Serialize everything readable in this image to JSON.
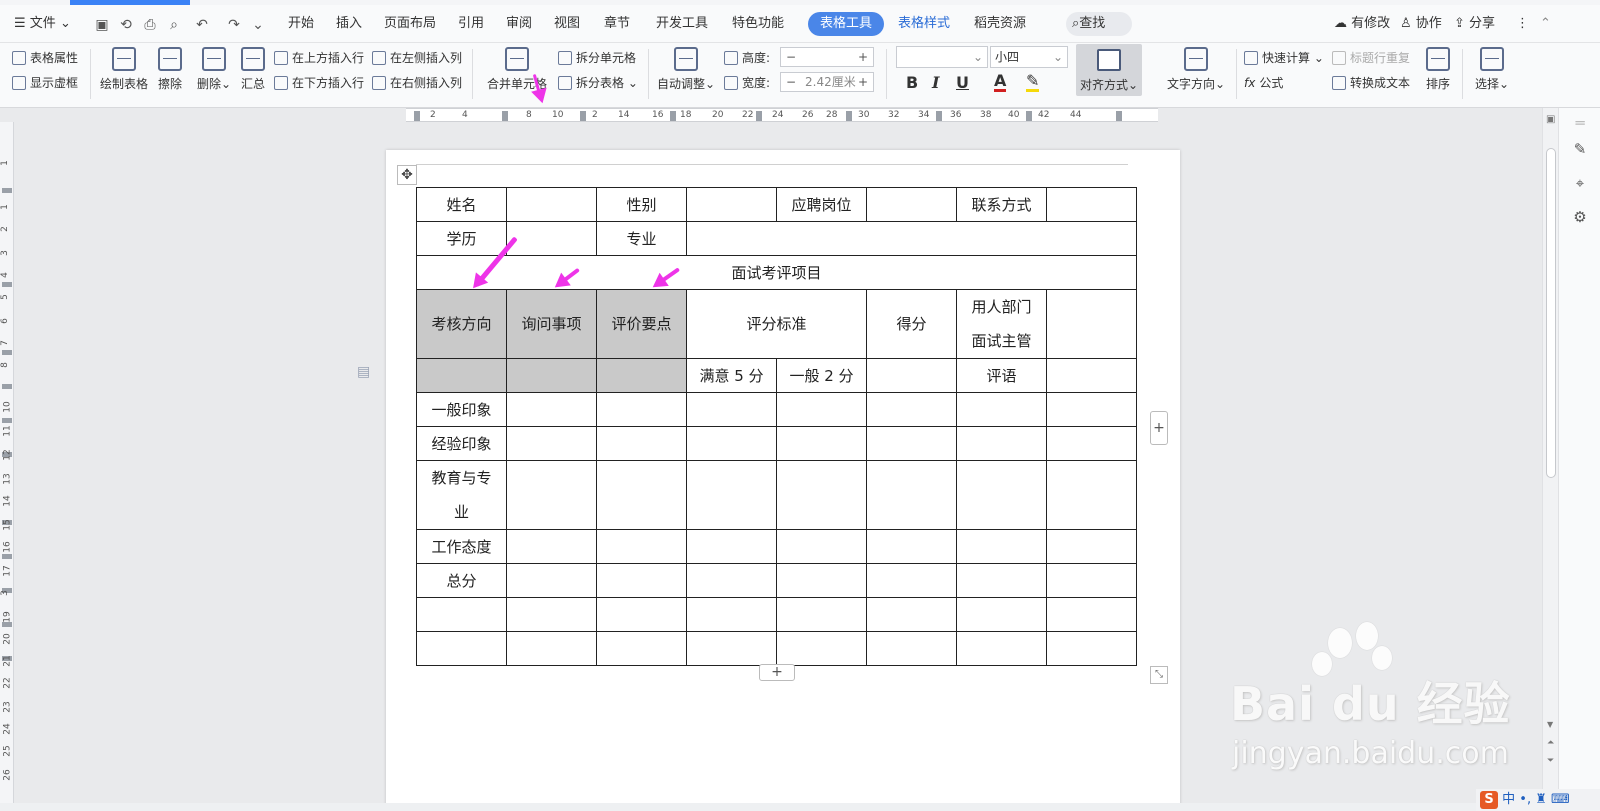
{
  "menubar": {
    "file": "文件",
    "tabs": [
      "开始",
      "插入",
      "页面布局",
      "引用",
      "审阅",
      "视图",
      "章节",
      "开发工具",
      "特色功能"
    ],
    "table_tools": "表格工具",
    "table_style": "表格样式",
    "docer": "稻壳资源",
    "search": "查找",
    "has_changes": "有修改",
    "collab": "协作",
    "share": "分享"
  },
  "ribbon": {
    "table_props": "表格属性",
    "show_grid": "显示虚框",
    "draw_table": "绘制表格",
    "erase": "擦除",
    "delete": "删除",
    "summary": "汇总",
    "insert_above": "在上方插入行",
    "insert_below": "在下方插入行",
    "insert_left": "在左侧插入列",
    "insert_right": "在右侧插入列",
    "merge_cells": "合并单元格",
    "split_cells": "拆分单元格",
    "split_table": "拆分表格",
    "auto_adjust": "自动调整",
    "height_label": "高度:",
    "width_label": "宽度:",
    "height_value": "",
    "width_value": "2.42厘米",
    "font_name": "",
    "font_size": "小四",
    "align": "对齐方式",
    "text_direction": "文字方向",
    "quick_calc": "快速计算",
    "repeat_header": "标题行重复",
    "formula": "公式",
    "to_text": "转换成文本",
    "sort": "排序",
    "select": "选择"
  },
  "ruler": {
    "ticks": [
      "2",
      "4",
      "8",
      "10",
      "2",
      "14",
      "16",
      "18",
      "20",
      "22",
      "24",
      "26",
      "28",
      "30",
      "32",
      "34",
      "36",
      "38",
      "40",
      "42",
      "44"
    ]
  },
  "vruler": {
    "ticks": [
      "1",
      "1",
      "2",
      "3",
      "4",
      "5",
      "6",
      "7",
      "8",
      "10",
      "11",
      "12",
      "13",
      "14",
      "15",
      "16",
      "17",
      "3",
      "19",
      "20",
      "21",
      "22",
      "23",
      "24",
      "25",
      "26"
    ]
  },
  "table": {
    "r1": [
      "姓名",
      "",
      "性别",
      "",
      "应聘岗位",
      "",
      "联系方式",
      ""
    ],
    "r2": [
      "学历",
      "",
      "专业",
      ""
    ],
    "r3": "面试考评项目",
    "r4": [
      "考核方向",
      "询问事项",
      "评价要点",
      "评分标准",
      "得分",
      "用人部门",
      "面试主管",
      ""
    ],
    "r5": [
      "",
      "",
      "",
      "满意 5 分",
      "一般 2 分",
      "",
      "评语",
      ""
    ],
    "rows": [
      [
        "一般印象",
        "",
        "",
        "",
        "",
        "",
        "",
        ""
      ],
      [
        "经验印象",
        "",
        "",
        "",
        "",
        "",
        "",
        ""
      ],
      [
        "教育与专",
        "业",
        "",
        "",
        "",
        "",
        "",
        ""
      ],
      [
        "工作态度",
        "",
        "",
        "",
        "",
        "",
        "",
        ""
      ],
      [
        "总分",
        "",
        "",
        "",
        "",
        "",
        "",
        ""
      ],
      [
        "",
        "",
        "",
        "",
        "",
        "",
        "",
        ""
      ],
      [
        "",
        "",
        "",
        "",
        "",
        "",
        "",
        ""
      ]
    ]
  },
  "watermark": {
    "brand": "Bai du 经验",
    "url": "jingyan.baidu.com"
  },
  "ime": {
    "logo": "S",
    "mode": "中"
  },
  "colors": {
    "accent": "#4a86e8",
    "arrow": "#ee34e8",
    "shade": "#c9c9c9"
  }
}
